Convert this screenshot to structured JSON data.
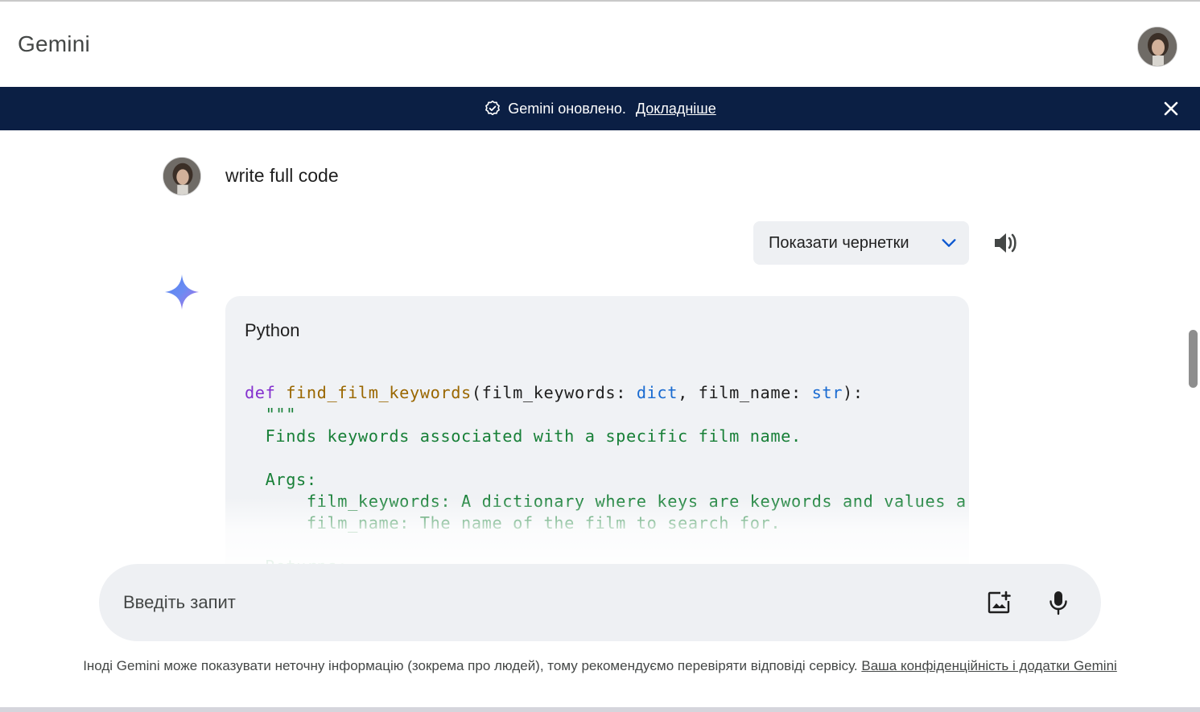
{
  "app": {
    "title": "Gemini"
  },
  "banner": {
    "text": "Gemini оновлено.",
    "link": "Докладніше",
    "icon": "verified-badge-icon",
    "close_icon": "close-icon",
    "background": "#0b1f44"
  },
  "conversation": {
    "user_message": "write full code",
    "drafts_button": "Показати чернетки",
    "code_block": {
      "language": "Python",
      "lines": [
        [
          {
            "t": "def ",
            "c": "kw"
          },
          {
            "t": "find_film_keywords",
            "c": "fn"
          },
          {
            "t": "(film_keywords: ",
            "c": ""
          },
          {
            "t": "dict",
            "c": "ty"
          },
          {
            "t": ", film_name: ",
            "c": ""
          },
          {
            "t": "str",
            "c": "ty"
          },
          {
            "t": "):",
            "c": ""
          }
        ],
        [
          {
            "t": "  \"\"\"",
            "c": "str"
          }
        ],
        [
          {
            "t": "  Finds keywords associated with a specific film name.",
            "c": "str"
          }
        ],
        [
          {
            "t": "",
            "c": ""
          }
        ],
        [
          {
            "t": "  Args:",
            "c": "str"
          }
        ],
        [
          {
            "t": "      film_keywords: A dictionary where keys are keywords and values are",
            "c": "str"
          }
        ],
        [
          {
            "t": "      film_name: The name of the film to search for.",
            "c": "str"
          }
        ],
        [
          {
            "t": "",
            "c": ""
          }
        ],
        [
          {
            "t": "  Returns:",
            "c": "str"
          }
        ]
      ]
    }
  },
  "input": {
    "placeholder": "Введіть запит"
  },
  "footer": {
    "disclaimer": "Іноді Gemini може показувати неточну інформацію (зокрема про людей), тому рекомендуємо перевіряти відповіді сервісу. ",
    "link": "Ваша конфіденційність і додатки Gemini"
  },
  "colors": {
    "accent": "#0b57d0",
    "surface": "#eef0f3",
    "code_keyword": "#8430ce",
    "code_function": "#9a6700",
    "code_type": "#1a6bd1",
    "code_string": "#188038"
  }
}
